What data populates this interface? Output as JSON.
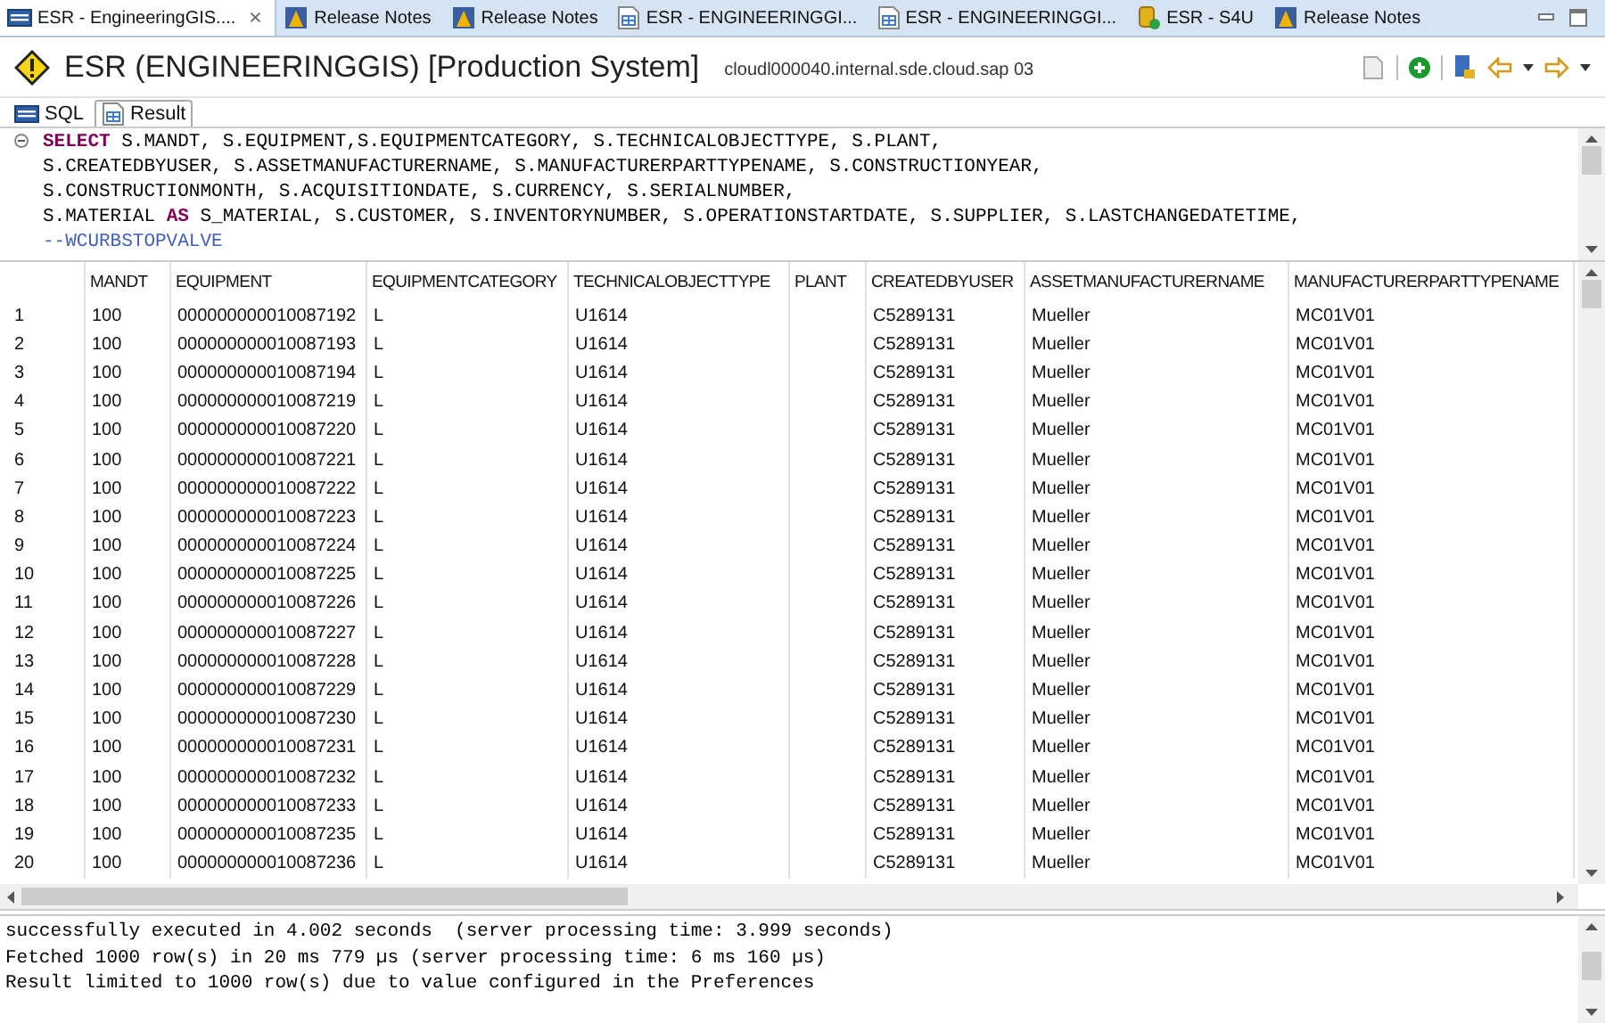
{
  "editor_tabs": [
    {
      "label": "ESR - EngineeringGIS....",
      "kind": "sql",
      "selected": true,
      "close": "⨯"
    },
    {
      "label": "Release Notes",
      "kind": "notes",
      "selected": false
    },
    {
      "label": "Release Notes",
      "kind": "notes",
      "selected": false
    },
    {
      "label": "ESR - ENGINEERINGGI...",
      "kind": "table",
      "selected": false
    },
    {
      "label": "ESR - ENGINEERINGGI...",
      "kind": "table",
      "selected": false
    },
    {
      "label": "ESR - S4U",
      "kind": "db",
      "selected": false
    },
    {
      "label": "Release Notes",
      "kind": "notes",
      "selected": false
    }
  ],
  "header": {
    "title": "ESR (ENGINEERINGGIS) [Production System]",
    "host": "cloudl000040.internal.sde.cloud.sap 03"
  },
  "sub_tabs": [
    {
      "label": "SQL",
      "kind": "sql",
      "selected": false
    },
    {
      "label": "Result",
      "kind": "table",
      "selected": true
    }
  ],
  "sql_lines": [
    [
      {
        "kind": "keyword",
        "text": "SELECT"
      },
      {
        "kind": "plain",
        "text": " S.MANDT, S.EQUIPMENT,S.EQUIPMENTCATEGORY, S.TECHNICALOBJECTTYPE, S.PLANT,"
      }
    ],
    [
      {
        "kind": "plain",
        "text": "S.CREATEDBYUSER, S.ASSETMANUFACTURERNAME, S.MANUFACTURERPARTTYPENAME, S.CONSTRUCTIONYEAR,"
      }
    ],
    [
      {
        "kind": "plain",
        "text": "S.CONSTRUCTIONMONTH, S.ACQUISITIONDATE, S.CURRENCY, S.SERIALNUMBER,"
      }
    ],
    [
      {
        "kind": "plain",
        "text": "S.MATERIAL "
      },
      {
        "kind": "keyword",
        "text": "AS"
      },
      {
        "kind": "plain",
        "text": " S_MATERIAL, S.CUSTOMER, S.INVENTORYNUMBER, S.OPERATIONSTARTDATE, S.SUPPLIER, S.LASTCHANGEDATETIME,"
      }
    ],
    [
      {
        "kind": "comment",
        "text": "--WCURBSTOPVALVE"
      }
    ]
  ],
  "table": {
    "columns": [
      "",
      "MANDT",
      "EQUIPMENT",
      "EQUIPMENTCATEGORY",
      "TECHNICALOBJECTTYPE",
      "PLANT",
      "CREATEDBYUSER",
      "ASSETMANUFACTURERNAME",
      "MANUFACTURERPARTTYPENAME"
    ],
    "rows": [
      [
        "1",
        "100",
        "000000000010087192",
        "L",
        "U1614",
        "",
        "C5289131",
        "Mueller",
        "MC01V01"
      ],
      [
        "2",
        "100",
        "000000000010087193",
        "L",
        "U1614",
        "",
        "C5289131",
        "Mueller",
        "MC01V01"
      ],
      [
        "3",
        "100",
        "000000000010087194",
        "L",
        "U1614",
        "",
        "C5289131",
        "Mueller",
        "MC01V01"
      ],
      [
        "4",
        "100",
        "000000000010087219",
        "L",
        "U1614",
        "",
        "C5289131",
        "Mueller",
        "MC01V01"
      ],
      [
        "5",
        "100",
        "000000000010087220",
        "L",
        "U1614",
        "",
        "C5289131",
        "Mueller",
        "MC01V01"
      ],
      [
        "6",
        "100",
        "000000000010087221",
        "L",
        "U1614",
        "",
        "C5289131",
        "Mueller",
        "MC01V01"
      ],
      [
        "7",
        "100",
        "000000000010087222",
        "L",
        "U1614",
        "",
        "C5289131",
        "Mueller",
        "MC01V01"
      ],
      [
        "8",
        "100",
        "000000000010087223",
        "L",
        "U1614",
        "",
        "C5289131",
        "Mueller",
        "MC01V01"
      ],
      [
        "9",
        "100",
        "000000000010087224",
        "L",
        "U1614",
        "",
        "C5289131",
        "Mueller",
        "MC01V01"
      ],
      [
        "10",
        "100",
        "000000000010087225",
        "L",
        "U1614",
        "",
        "C5289131",
        "Mueller",
        "MC01V01"
      ],
      [
        "11",
        "100",
        "000000000010087226",
        "L",
        "U1614",
        "",
        "C5289131",
        "Mueller",
        "MC01V01"
      ],
      [
        "12",
        "100",
        "000000000010087227",
        "L",
        "U1614",
        "",
        "C5289131",
        "Mueller",
        "MC01V01"
      ],
      [
        "13",
        "100",
        "000000000010087228",
        "L",
        "U1614",
        "",
        "C5289131",
        "Mueller",
        "MC01V01"
      ],
      [
        "14",
        "100",
        "000000000010087229",
        "L",
        "U1614",
        "",
        "C5289131",
        "Mueller",
        "MC01V01"
      ],
      [
        "15",
        "100",
        "000000000010087230",
        "L",
        "U1614",
        "",
        "C5289131",
        "Mueller",
        "MC01V01"
      ],
      [
        "16",
        "100",
        "000000000010087231",
        "L",
        "U1614",
        "",
        "C5289131",
        "Mueller",
        "MC01V01"
      ],
      [
        "17",
        "100",
        "000000000010087232",
        "L",
        "U1614",
        "",
        "C5289131",
        "Mueller",
        "MC01V01"
      ],
      [
        "18",
        "100",
        "000000000010087233",
        "L",
        "U1614",
        "",
        "C5289131",
        "Mueller",
        "MC01V01"
      ],
      [
        "19",
        "100",
        "000000000010087235",
        "L",
        "U1614",
        "",
        "C5289131",
        "Mueller",
        "MC01V01"
      ],
      [
        "20",
        "100",
        "000000000010087236",
        "L",
        "U1614",
        "",
        "C5289131",
        "Mueller",
        "MC01V01"
      ]
    ]
  },
  "console_lines": [
    "successfully executed in 4.002 seconds  (server processing time: 3.999 seconds)",
    "Fetched 1000 row(s) in 20 ms 779 µs (server processing time: 6 ms 160 µs)",
    "Result limited to 1000 row(s) due to value configured in the Preferences"
  ]
}
